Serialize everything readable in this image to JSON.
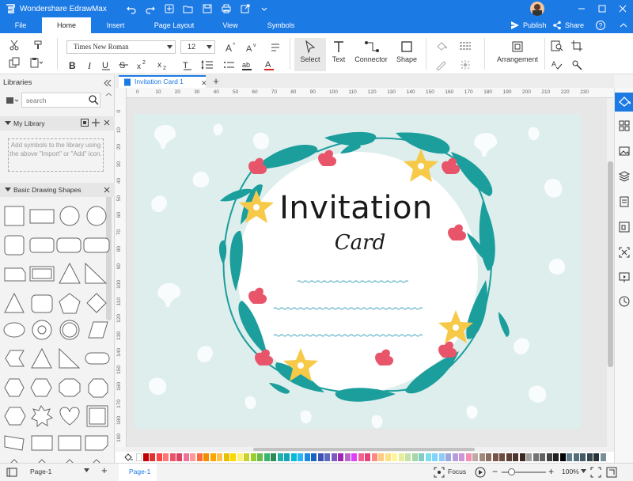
{
  "app": {
    "title": "Wondershare EdrawMax"
  },
  "ribbon": {
    "tabs": [
      "File",
      "Home",
      "Insert",
      "Page Layout",
      "View",
      "Symbols"
    ],
    "active_tab": "Home",
    "publish_label": "Publish",
    "share_label": "Share"
  },
  "toolbar": {
    "font_family": "Times New Roman",
    "font_size": "12",
    "select_label": "Select",
    "text_label": "Text",
    "connector_label": "Connector",
    "shape_label": "Shape",
    "arrangement_label": "Arrangement"
  },
  "library": {
    "title": "Libraries",
    "search_placeholder": "search",
    "my_library": "My Library",
    "my_library_hint": "Add symbols to the library using the above \"Import\" or \"Add\" icon.",
    "basic_shapes": "Basic Drawing Shapes"
  },
  "document": {
    "tab_title": "Invitation Card 1",
    "card_title": "Invitation",
    "card_subtitle": "Card"
  },
  "rulers": {
    "h_ticks": [
      "0",
      "10",
      "20",
      "30",
      "40",
      "50",
      "60",
      "70",
      "80",
      "90",
      "100",
      "110",
      "120",
      "130",
      "140",
      "150",
      "160",
      "170",
      "180",
      "190",
      "200",
      "210",
      "220",
      "230"
    ],
    "v_ticks": [
      "0",
      "10",
      "20",
      "30",
      "40",
      "50",
      "60",
      "70",
      "80",
      "90",
      "100",
      "110",
      "120",
      "130",
      "140",
      "150",
      "160",
      "170",
      "180",
      "190"
    ]
  },
  "palette": [
    "#ffffff",
    "#c00000",
    "#e03030",
    "#ff4444",
    "#ff7777",
    "#e8556a",
    "#d9455f",
    "#f2719a",
    "#ff9999",
    "#ff6a3d",
    "#f08c00",
    "#ffa500",
    "#ffc34d",
    "#e5c100",
    "#ffd700",
    "#fff176",
    "#c8d12e",
    "#9acd32",
    "#6abe45",
    "#3cb371",
    "#2e8b57",
    "#20b2aa",
    "#17a2b8",
    "#00bcd4",
    "#29b6f6",
    "#1e88e5",
    "#1565c0",
    "#3f51b5",
    "#5c6bc0",
    "#7e57c2",
    "#9c27b0",
    "#ba68c8",
    "#e040fb",
    "#f06292",
    "#ec407a",
    "#ff8a80",
    "#ffcc80",
    "#ffe082",
    "#fff59d",
    "#e6ee9c",
    "#c5e1a5",
    "#a5d6a7",
    "#80cbc4",
    "#80deea",
    "#81d4fa",
    "#90caf9",
    "#9fa8da",
    "#b39ddb",
    "#ce93d8",
    "#f48fb1",
    "#bcaaa4",
    "#a1887f",
    "#8d6e63",
    "#795548",
    "#6d4c41",
    "#5d4037",
    "#4e342e",
    "#3e2723",
    "#9e9e9e",
    "#757575",
    "#616161",
    "#424242",
    "#212121",
    "#000000",
    "#607d8b",
    "#546e7a",
    "#455a64",
    "#37474f",
    "#263238",
    "#78909c"
  ],
  "status": {
    "page_select": "Page-1",
    "page_tab": "Page-1",
    "focus_label": "Focus",
    "zoom": "100%"
  }
}
